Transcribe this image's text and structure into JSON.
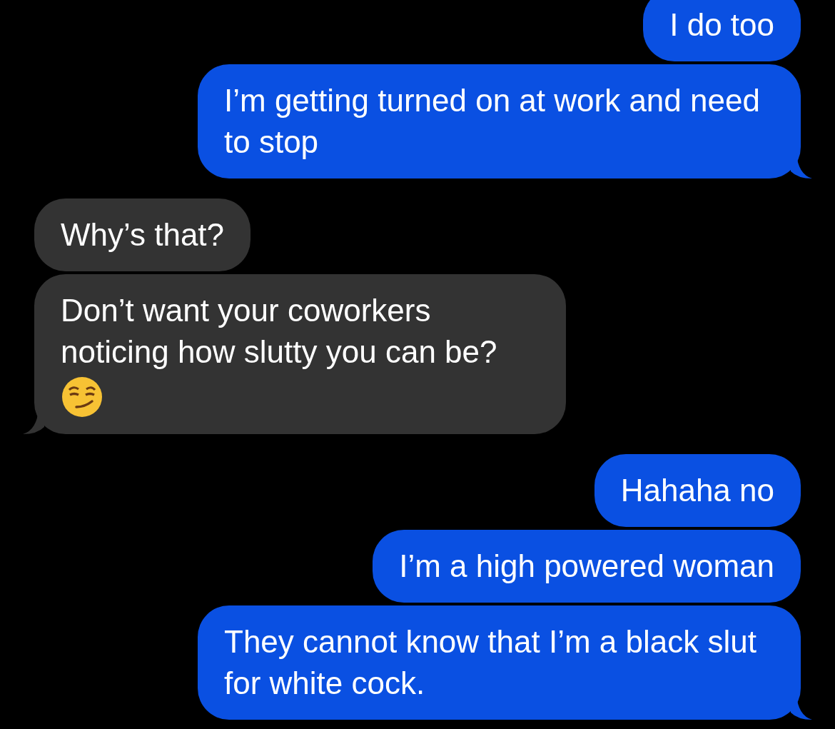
{
  "messages": [
    {
      "outgoing": true,
      "kind": "text",
      "text": "I do too",
      "tail": false
    },
    {
      "outgoing": true,
      "kind": "text",
      "text": "I’m getting turned on at work and need to stop",
      "tail": true
    },
    {
      "outgoing": false,
      "kind": "text",
      "text": "Why’s that?",
      "tail": false
    },
    {
      "outgoing": false,
      "kind": "text_with_emoji",
      "text": "Don’t want your coworkers noticing how slutty you can be?",
      "tail": true
    },
    {
      "outgoing": true,
      "kind": "text",
      "text": "Hahaha no",
      "tail": false
    },
    {
      "outgoing": true,
      "kind": "text",
      "text": "I’m a high powered woman",
      "tail": false
    },
    {
      "outgoing": true,
      "kind": "text",
      "text": "They cannot know that I’m a black slut for white cock.",
      "tail": true
    }
  ]
}
